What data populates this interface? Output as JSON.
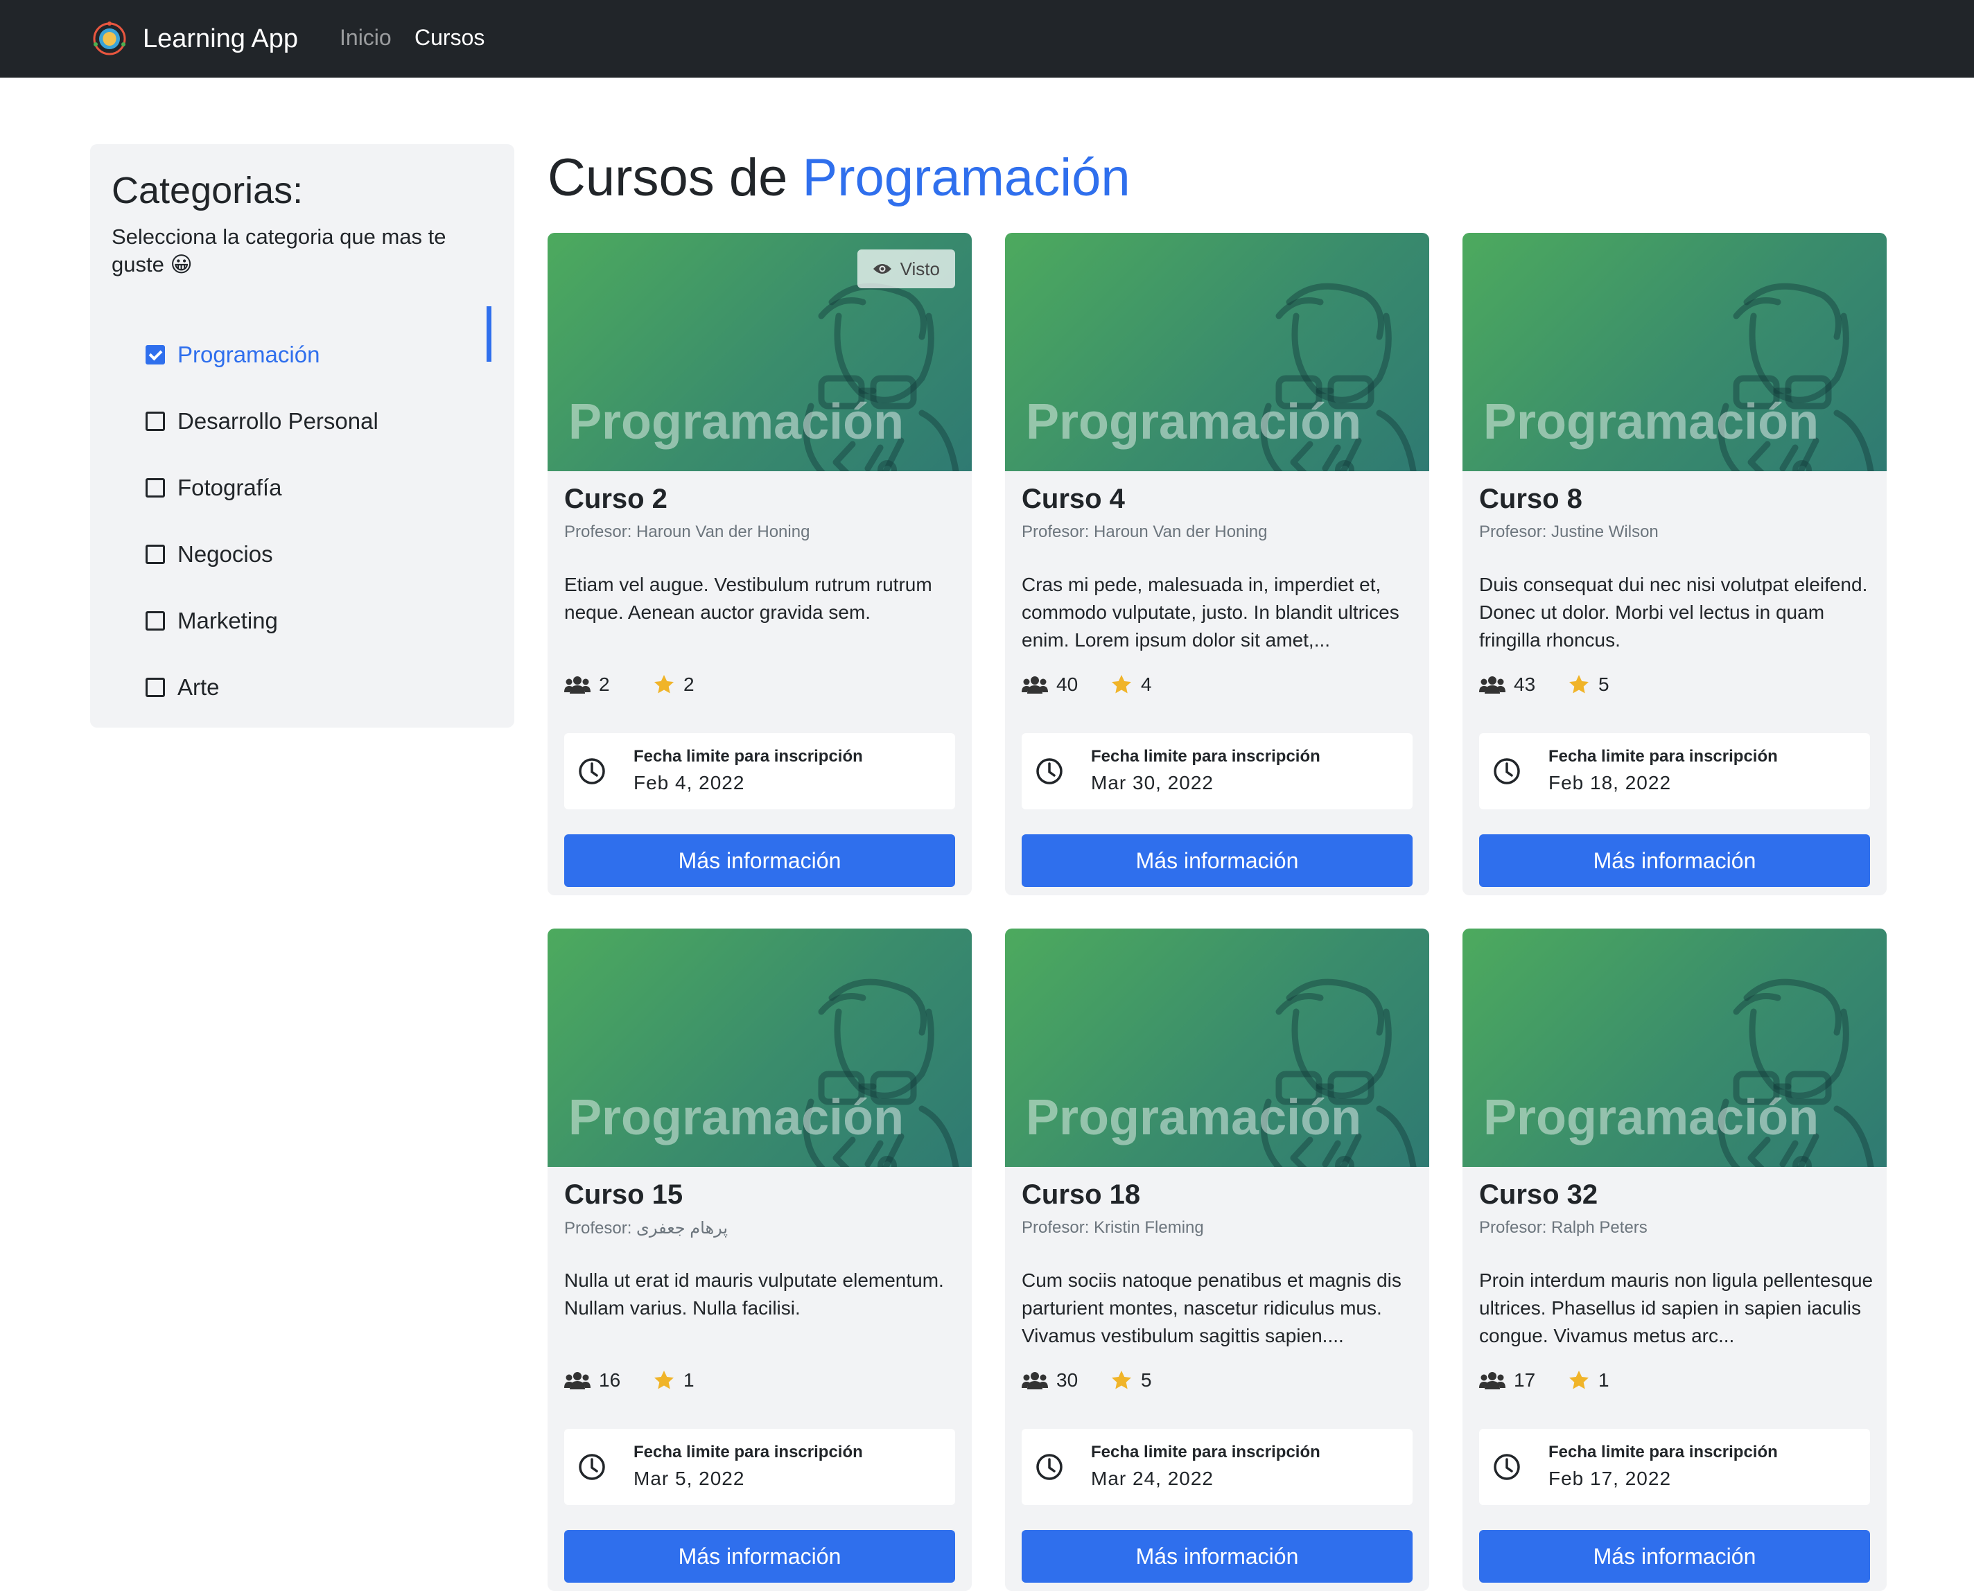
{
  "navbar": {
    "brand": "Learning App",
    "links": [
      {
        "label": "Inicio",
        "active": false
      },
      {
        "label": "Cursos",
        "active": true
      }
    ]
  },
  "sidebar": {
    "title": "Categorias:",
    "subtitle": "Selecciona la categoria que mas te guste 😀",
    "categories": [
      {
        "label": "Programación",
        "checked": true
      },
      {
        "label": "Desarrollo Personal",
        "checked": false
      },
      {
        "label": "Fotografía",
        "checked": false
      },
      {
        "label": "Negocios",
        "checked": false
      },
      {
        "label": "Marketing",
        "checked": false
      },
      {
        "label": "Arte",
        "checked": false
      }
    ]
  },
  "main": {
    "title_prefix": "Cursos de",
    "title_category": "Programación"
  },
  "colors": {
    "accent": "#2f6fed",
    "navbar": "#212529",
    "star": "#f0b429"
  },
  "cards": [
    {
      "thumb_label": "Programación",
      "badge": "Visto",
      "title": "Curso 2",
      "professor": "Profesor: Haroun Van der Honing",
      "description": "Etiam vel augue. Vestibulum rutrum rutrum neque. Aenean auctor gravida sem.",
      "students": "2",
      "rating": "2",
      "deadline_label": "Fecha limite para inscripción",
      "deadline_date": "Feb 4, 2022",
      "button": "Más información"
    },
    {
      "thumb_label": "Programación",
      "title": "Curso 4",
      "professor": "Profesor: Haroun Van der Honing",
      "description": "Cras mi pede, malesuada in, imperdiet et, commodo vulputate, justo. In blandit ultrices enim. Lorem ipsum dolor sit amet,...",
      "students": "40",
      "rating": "4",
      "deadline_label": "Fecha limite para inscripción",
      "deadline_date": "Mar 30, 2022",
      "button": "Más información"
    },
    {
      "thumb_label": "Programación",
      "title": "Curso 8",
      "professor": "Profesor: Justine Wilson",
      "description": "Duis consequat dui nec nisi volutpat eleifend. Donec ut dolor. Morbi vel lectus in quam fringilla rhoncus.",
      "students": "43",
      "rating": "5",
      "deadline_label": "Fecha limite para inscripción",
      "deadline_date": "Feb 18, 2022",
      "button": "Más información"
    },
    {
      "thumb_label": "Programación",
      "title": "Curso 15",
      "professor": "Profesor: پرهام جعفری",
      "description": "Nulla ut erat id mauris vulputate elementum. Nullam varius. Nulla facilisi.",
      "students": "16",
      "rating": "1",
      "deadline_label": "Fecha limite para inscripción",
      "deadline_date": "Mar 5, 2022",
      "button": "Más información"
    },
    {
      "thumb_label": "Programación",
      "title": "Curso 18",
      "professor": "Profesor: Kristin Fleming",
      "description": "Cum sociis natoque penatibus et magnis dis parturient montes, nascetur ridiculus mus. Vivamus vestibulum sagittis sapien....",
      "students": "30",
      "rating": "5",
      "deadline_label": "Fecha limite para inscripción",
      "deadline_date": "Mar 24, 2022",
      "button": "Más información"
    },
    {
      "thumb_label": "Programación",
      "title": "Curso 32",
      "professor": "Profesor: Ralph Peters",
      "description": "Proin interdum mauris non ligula pellentesque ultrices. Phasellus id sapien in sapien iaculis congue. Vivamus metus arc...",
      "students": "17",
      "rating": "1",
      "deadline_label": "Fecha limite para inscripción",
      "deadline_date": "Feb 17, 2022",
      "button": "Más información"
    }
  ]
}
